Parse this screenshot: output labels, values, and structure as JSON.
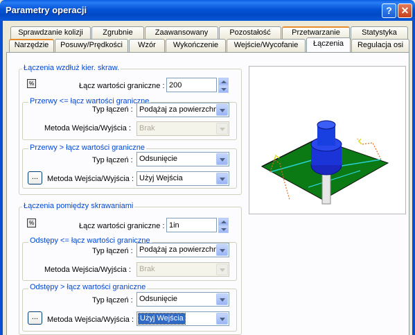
{
  "window": {
    "title": "Parametry operacji",
    "help_label": "?",
    "close_label": "✕"
  },
  "tabs_row1": [
    "Sprawdzanie kolizji",
    "Zgrubnie",
    "Zaawansowany",
    "Pozostałość",
    "Przetwarzanie",
    "Statystyka"
  ],
  "tabs_row2": [
    "Narzędzie",
    "Posuwy/Prędkości",
    "Wzór",
    "Wykończenie",
    "Wejście/Wycofanie",
    "Łączenia",
    "Regulacja osi"
  ],
  "along": {
    "group_label": "Łączenia wzdłuż kier. skraw.",
    "limit_label": "Łącz wartości graniczne :",
    "limit_value": "200",
    "gaps_le": {
      "label": "Przerwy <= łącz wartości graniczne",
      "type_label": "Typ łączeń :",
      "type_value": "Podążaj za powierzchnią",
      "method_label": "Metoda Wejścia/Wyjścia :",
      "method_value": "Brak"
    },
    "gaps_gt": {
      "label": "Przerwy > łącz wartości graniczne",
      "type_label": "Typ łączeń :",
      "type_value": "Odsunięcie",
      "method_label": "Metoda Wejścia/Wyjścia :",
      "method_value": "Użyj Wejścia"
    }
  },
  "between": {
    "group_label": "Łączenia pomiędzy skrawaniami",
    "limit_label": "Łącz wartości graniczne :",
    "limit_value": "1in",
    "gaps_le": {
      "label": "Odstępy <= łącz wartości graniczne",
      "type_label": "Typ łączeń :",
      "type_value": "Podążaj za powierzchnią",
      "method_label": "Metoda Wejścia/Wyjścia :",
      "method_value": "Brak"
    },
    "gaps_gt": {
      "label": "Odstępy > łącz wartości graniczne",
      "type_label": "Typ łączeń :",
      "type_value": "Odsunięcie",
      "method_label": "Metoda Wejścia/Wyjścia :",
      "method_value": "Użyj Wejścia"
    }
  },
  "ellipsis": "...",
  "colors": {
    "accent": "#0046d5",
    "title_bar": "#0454d6",
    "selection": "#316ac5",
    "plane": "#0b7a14",
    "tool": "#1030c8"
  }
}
